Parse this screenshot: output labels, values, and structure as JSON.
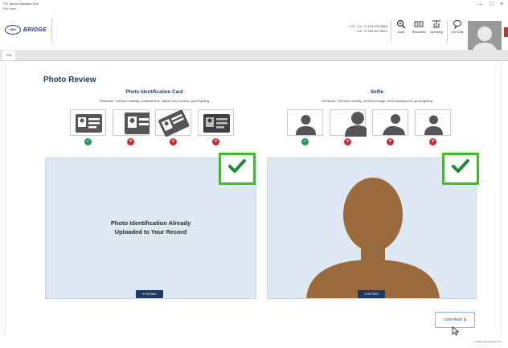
{
  "window": {
    "title": "ITS Secure Browser Exit",
    "menu": "File View",
    "controls": {
      "minimize": "–",
      "maximize": "□",
      "close": "×"
    }
  },
  "header": {
    "logo_mark": "ISM",
    "logo_text": "BRIDGE",
    "contact_line1": "U.S., Ca. +1 194 876 5665",
    "contact_line2": "Intl. +1 284 507 8810",
    "buttons": [
      {
        "label": "Zoom",
        "icon": "zoom-icon"
      },
      {
        "label": "Resources",
        "icon": "keyboard-icon"
      },
      {
        "label": "Operating",
        "icon": "adjust-icon"
      },
      {
        "label": "Live Chat",
        "icon": "chat-icon"
      }
    ]
  },
  "tabs": [
    {
      "label": "PIV"
    }
  ],
  "main": {
    "title": "Photo Review",
    "id_card": {
      "title": "Photo Identification Card",
      "note": "Reminder: Full face visibility, readable text, visible card corners, good lighting",
      "statuses": [
        "ok",
        "bad",
        "bad",
        "bad"
      ],
      "panel_message_line1": "Photo Identification Already",
      "panel_message_line2": "Uploaded to Your Record",
      "retake_label": "⟲ RETAKE"
    },
    "selfie": {
      "title": "Selfie",
      "note": "Reminder: Full face visibility, centered image, clean background, good lighting",
      "statuses": [
        "ok",
        "bad",
        "bad",
        "bad"
      ],
      "retake_label": "⟲ RETAKE"
    },
    "continue_label": "CONTINUE ❯"
  },
  "footer": {
    "copyright": "© 2023 ITS Services LLC"
  },
  "colors": {
    "accent": "#1f3a66",
    "ok": "#1f9d55",
    "bad": "#c62c32",
    "highlight": "#3bbd25",
    "panel": "#dde8f2",
    "selfie_silhouette": "#9a6a3c"
  }
}
